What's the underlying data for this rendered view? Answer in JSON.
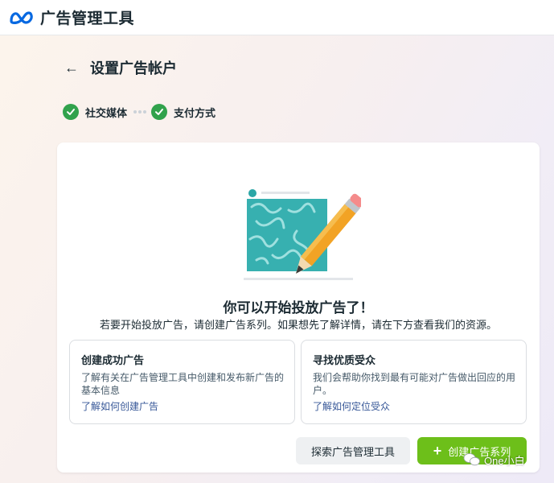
{
  "app": {
    "title": "广告管理工具",
    "logo": "meta-logo"
  },
  "header": {
    "back_icon": "back-arrow-icon",
    "title": "设置广告帐户"
  },
  "steps": [
    {
      "label": "社交媒体",
      "status": "complete"
    },
    {
      "label": "支付方式",
      "status": "complete"
    }
  ],
  "main": {
    "headline": "你可以开始投放广告了！",
    "subtitle": "若要开始投放广告，请创建广告系列。如果想先了解详情，请在下方查看我们的资源。",
    "cards": [
      {
        "title": "创建成功广告",
        "description": "了解有关在广告管理工具中创建和发布新广告的基本信息",
        "link": "了解如何创建广告"
      },
      {
        "title": "寻找优质受众",
        "description": "我们会帮助你找到最有可能对广告做出回应的用户。",
        "link": "了解如何定位受众"
      }
    ],
    "buttons": {
      "explore": "探索广告管理工具",
      "create": "创建广告系列"
    }
  },
  "watermark": "One小白",
  "colors": {
    "success": "#31a24c",
    "primary": "#6dbf1a",
    "link": "#385898",
    "meta_blue": "#0668e1"
  }
}
